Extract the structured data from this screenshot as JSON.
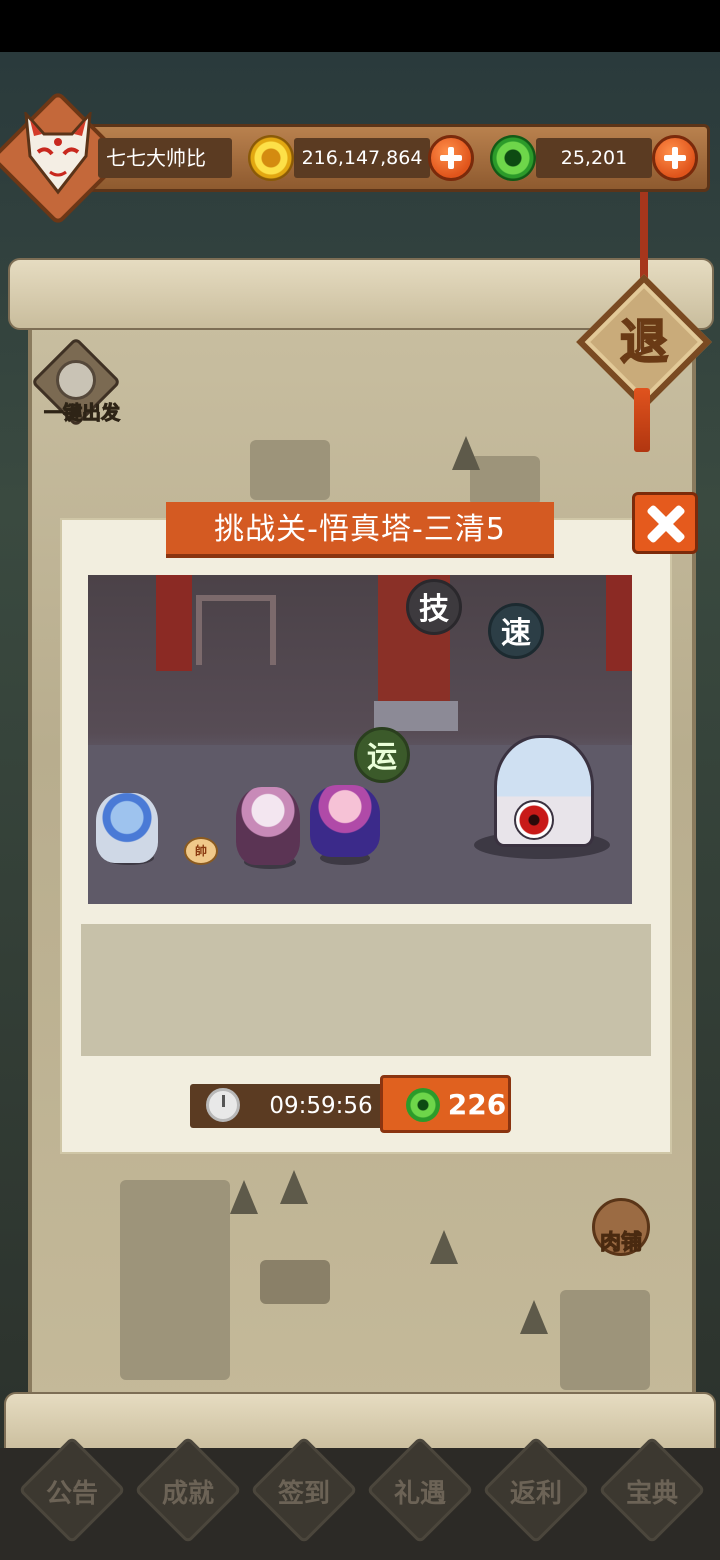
{
  "player": {
    "name": "七七大帅比",
    "gold": "216,147,864",
    "jade": "25,201"
  },
  "map": {
    "exit_label": "退",
    "quick_start_label": "一键出发",
    "shop_label": "肉铺"
  },
  "dialog": {
    "title": "挑战关-悟真塔-三清5",
    "timer": "09:59:56",
    "cost": "226",
    "badges": {
      "skill": "技",
      "speed": "速",
      "luck": "运"
    },
    "pet_label": "帥"
  },
  "bottom_menu": [
    {
      "label": "公告"
    },
    {
      "label": "成就"
    },
    {
      "label": "签到"
    },
    {
      "label": "礼遇"
    },
    {
      "label": "返利"
    },
    {
      "label": "宝典"
    }
  ]
}
